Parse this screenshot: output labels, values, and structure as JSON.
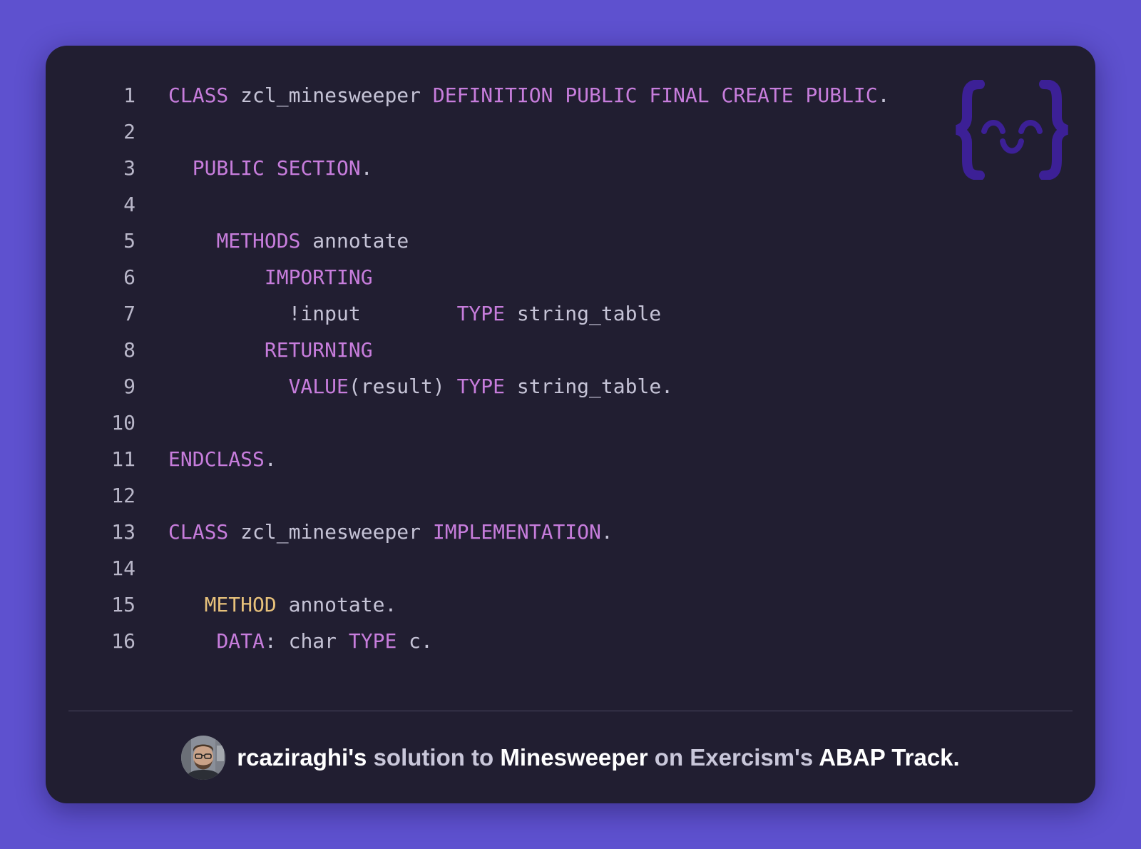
{
  "code": {
    "lines": [
      {
        "num": "1",
        "tokens": [
          {
            "t": "CLASS",
            "k": "kw"
          },
          {
            "t": " zcl_minesweeper ",
            "k": ""
          },
          {
            "t": "DEFINITION",
            "k": "kw"
          },
          {
            "t": " ",
            "k": ""
          },
          {
            "t": "PUBLIC",
            "k": "kw"
          },
          {
            "t": " ",
            "k": ""
          },
          {
            "t": "FINAL",
            "k": "kw"
          },
          {
            "t": " ",
            "k": ""
          },
          {
            "t": "CREATE",
            "k": "kw"
          },
          {
            "t": " ",
            "k": ""
          },
          {
            "t": "PUBLIC",
            "k": "kw"
          },
          {
            "t": ".",
            "k": ""
          }
        ]
      },
      {
        "num": "2",
        "tokens": []
      },
      {
        "num": "3",
        "tokens": [
          {
            "t": "  ",
            "k": ""
          },
          {
            "t": "PUBLIC",
            "k": "kw"
          },
          {
            "t": " ",
            "k": ""
          },
          {
            "t": "SECTION",
            "k": "kw"
          },
          {
            "t": ".",
            "k": ""
          }
        ]
      },
      {
        "num": "4",
        "tokens": []
      },
      {
        "num": "5",
        "tokens": [
          {
            "t": "    ",
            "k": ""
          },
          {
            "t": "METHODS",
            "k": "kw"
          },
          {
            "t": " annotate",
            "k": ""
          }
        ]
      },
      {
        "num": "6",
        "tokens": [
          {
            "t": "        ",
            "k": ""
          },
          {
            "t": "IMPORTING",
            "k": "kw"
          }
        ]
      },
      {
        "num": "7",
        "tokens": [
          {
            "t": "          !input        ",
            "k": ""
          },
          {
            "t": "TYPE",
            "k": "kw"
          },
          {
            "t": " string_table",
            "k": ""
          }
        ]
      },
      {
        "num": "8",
        "tokens": [
          {
            "t": "        ",
            "k": ""
          },
          {
            "t": "RETURNING",
            "k": "kw"
          }
        ]
      },
      {
        "num": "9",
        "tokens": [
          {
            "t": "          ",
            "k": ""
          },
          {
            "t": "VALUE",
            "k": "kw"
          },
          {
            "t": "(result) ",
            "k": ""
          },
          {
            "t": "TYPE",
            "k": "kw"
          },
          {
            "t": " string_table.",
            "k": ""
          }
        ]
      },
      {
        "num": "10",
        "tokens": []
      },
      {
        "num": "11",
        "tokens": [
          {
            "t": "ENDCLASS",
            "k": "kw"
          },
          {
            "t": ".",
            "k": ""
          }
        ]
      },
      {
        "num": "12",
        "tokens": []
      },
      {
        "num": "13",
        "tokens": [
          {
            "t": "CLASS",
            "k": "kw"
          },
          {
            "t": " zcl_minesweeper ",
            "k": ""
          },
          {
            "t": "IMPLEMENTATION",
            "k": "kw"
          },
          {
            "t": ".",
            "k": ""
          }
        ]
      },
      {
        "num": "14",
        "tokens": []
      },
      {
        "num": "15",
        "tokens": [
          {
            "t": "   ",
            "k": ""
          },
          {
            "t": "METHOD",
            "k": "kw2"
          },
          {
            "t": " annotate.",
            "k": ""
          }
        ]
      },
      {
        "num": "16",
        "tokens": [
          {
            "t": "    ",
            "k": ""
          },
          {
            "t": "DATA",
            "k": "kw"
          },
          {
            "t": ": char ",
            "k": ""
          },
          {
            "t": "TYPE",
            "k": "kw"
          },
          {
            "t": " c.",
            "k": ""
          }
        ]
      }
    ]
  },
  "logo": {
    "icon": "exercism-logo-icon"
  },
  "footer": {
    "avatar_icon": "user-avatar",
    "author": "rcaziraghi's",
    "text1": " solution to ",
    "exercise": "Minesweeper",
    "text2": " on ",
    "site": "Exercism's",
    "text3": " ",
    "track": "ABAP Track."
  },
  "colors": {
    "background": "#5e51cf",
    "card": "#211e31",
    "keyword": "#c77ddc",
    "method_keyword": "#e7c17b",
    "plain": "#c5c3d6"
  }
}
